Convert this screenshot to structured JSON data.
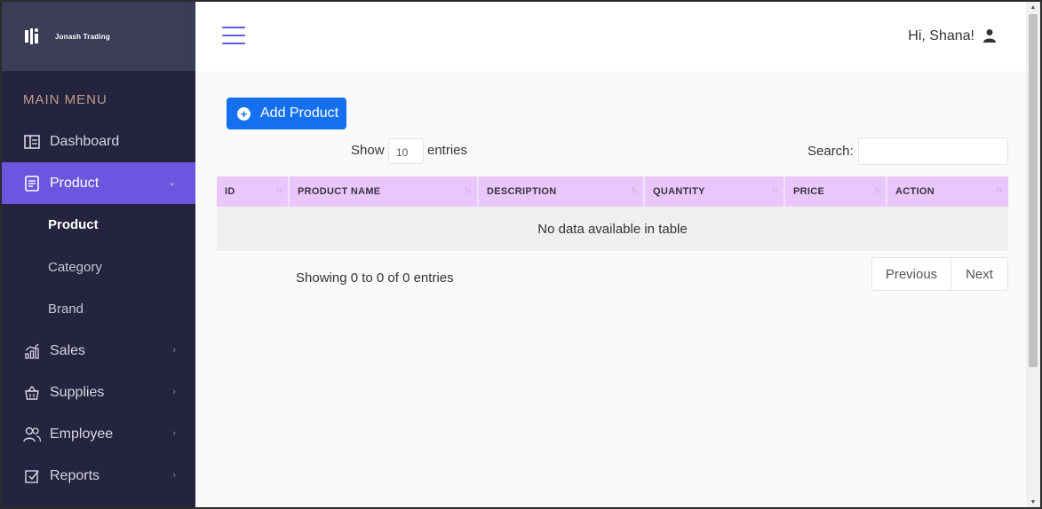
{
  "brand": {
    "name": "Jonash Trading",
    "logo_icon": "brand-logo-icon"
  },
  "sidebar": {
    "heading": "MAIN MENU",
    "items": [
      {
        "label": "Dashboard",
        "icon": "dashboard-icon"
      },
      {
        "label": "Product",
        "icon": "document-icon",
        "active": true
      },
      {
        "label": "Sales",
        "icon": "chart-icon"
      },
      {
        "label": "Supplies",
        "icon": "basket-icon"
      },
      {
        "label": "Employee",
        "icon": "users-icon"
      },
      {
        "label": "Reports",
        "icon": "checkbox-icon"
      }
    ],
    "subitems": [
      {
        "label": "Product",
        "current": true
      },
      {
        "label": "Category"
      },
      {
        "label": "Brand"
      }
    ]
  },
  "header": {
    "greeting": "Hi,  Shana!"
  },
  "main": {
    "add_button": "Add Product",
    "length": {
      "show": "Show",
      "value": "10",
      "entries": "entries"
    },
    "search": {
      "label": "Search:",
      "value": ""
    },
    "table": {
      "columns": [
        "ID",
        "PRODUCT NAME",
        "DESCRIPTION",
        "QUANTITY",
        "PRICE",
        "ACTION"
      ],
      "empty_message": "No data available in table"
    },
    "info": "Showing 0 to 0 of 0 entries",
    "pagination": {
      "previous": "Previous",
      "next": "Next"
    }
  },
  "colors": {
    "sidebar_bg": "#24243e",
    "brand_bg": "#3b3c58",
    "active_item": "#6e55e0",
    "primary_button": "#1570ef",
    "table_header": "#e9c7fb",
    "menu_heading": "#c49b8e"
  }
}
